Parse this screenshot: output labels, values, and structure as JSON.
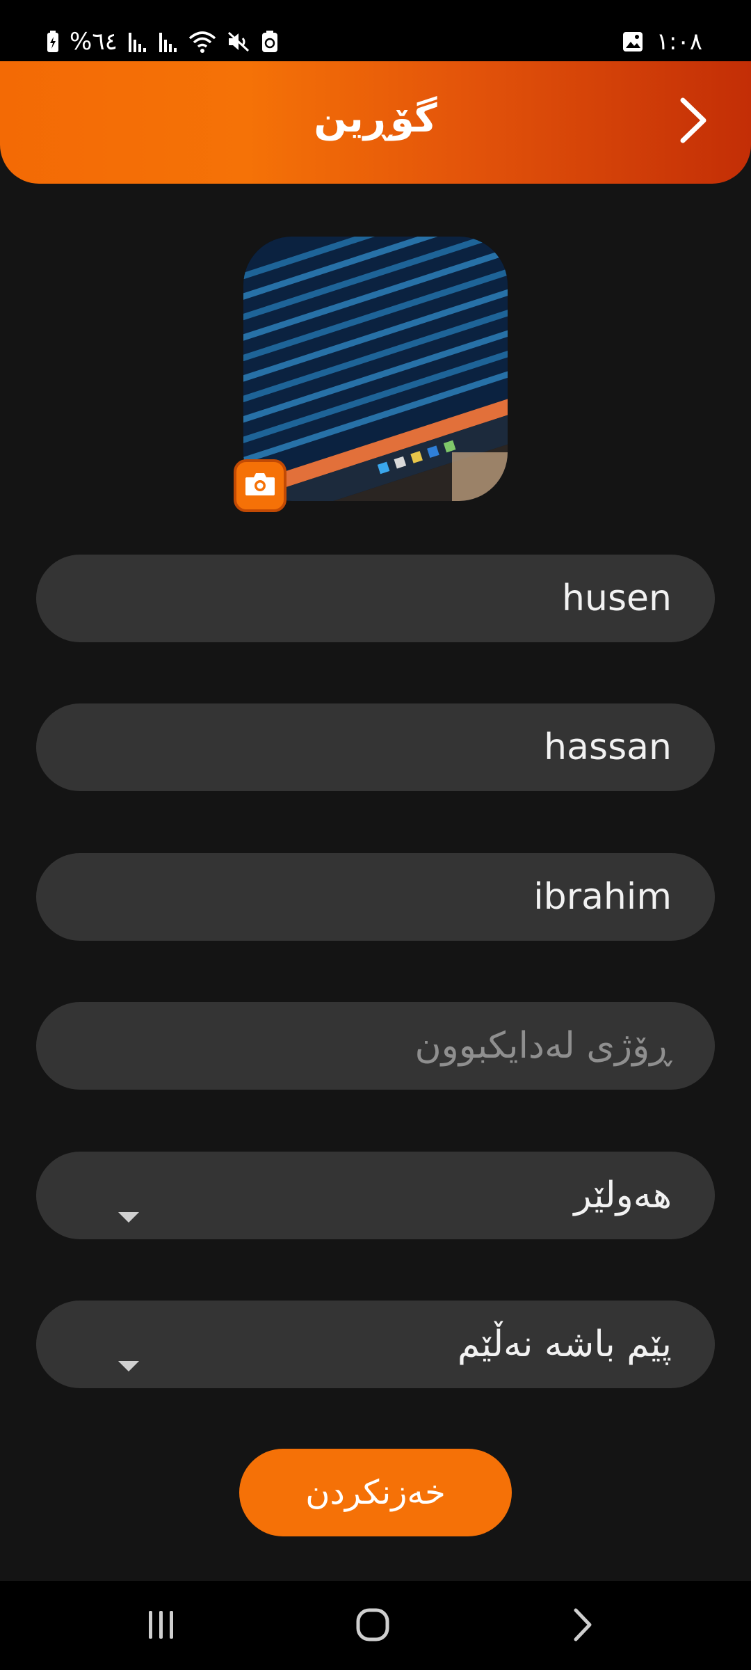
{
  "status_bar": {
    "battery_text": "%٦٤",
    "time": "١:٠٨",
    "icons": [
      "battery-charging-icon",
      "signal-icon",
      "signal-icon",
      "wifi-icon",
      "mute-icon",
      "recycle-icon",
      "gallery-icon"
    ]
  },
  "header": {
    "title": "گۆڕین",
    "back_icon": "chevron-right-icon"
  },
  "avatar": {
    "camera_icon": "camera-icon"
  },
  "form": {
    "first_name": "husen",
    "middle_name": "hassan",
    "last_name": "ibrahim",
    "birthdate_placeholder": "ڕۆژی لەدایکبوون",
    "city": "هەولێر",
    "gender": "پێم باشە نەڵێم"
  },
  "actions": {
    "save_label": "خەزنکردن"
  },
  "nav": {
    "recents_icon": "recents-icon",
    "home_icon": "home-icon",
    "back_icon": "nav-back-icon"
  },
  "colors": {
    "accent": "#f57107",
    "header_end": "#c32e06",
    "background": "#141414",
    "field": "#343434"
  }
}
